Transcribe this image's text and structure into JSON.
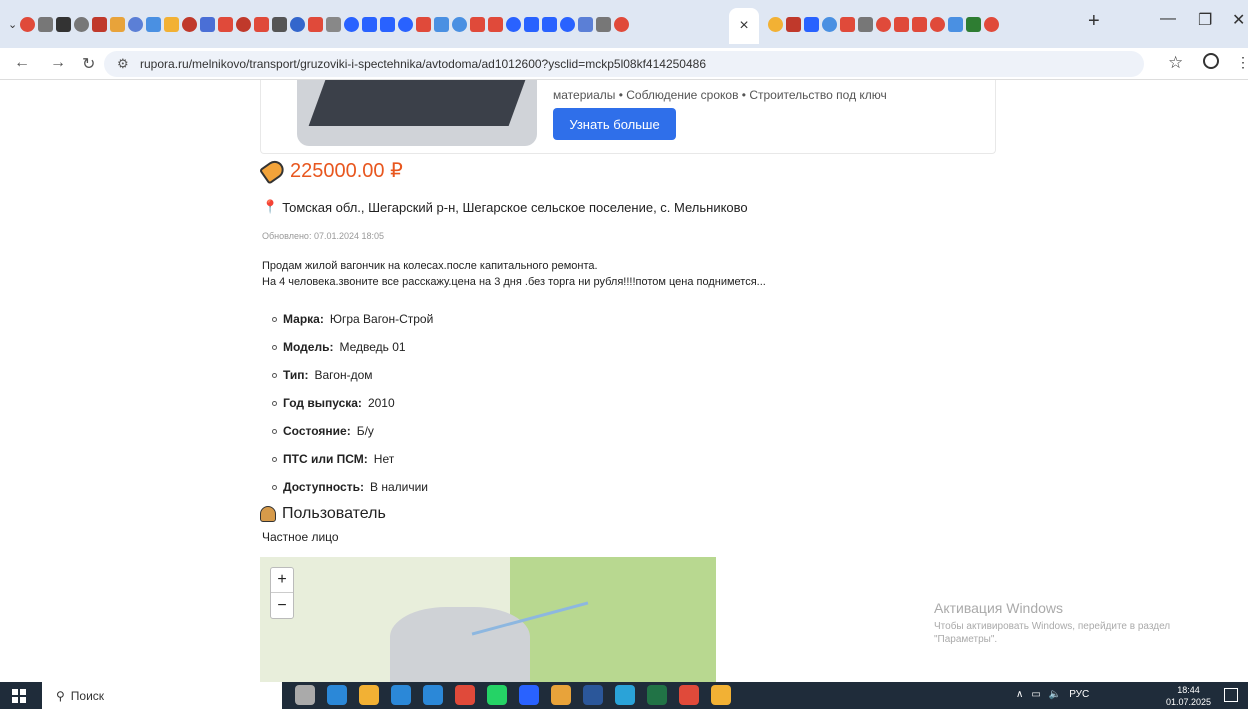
{
  "browser": {
    "url": "rupora.ru/melnikovo/transport/gruzoviki-i-spectehnika/avtodoma/ad1012600?ysclid=mckp5l08kf414250486",
    "active_tab_close": "×",
    "new_tab": "+",
    "tab_icon_colors": [
      "#e04a3a",
      "#777",
      "#333",
      "#777",
      "#c0392b",
      "#e8a33a",
      "#5b7fd6",
      "#4a90e2",
      "#f2b134",
      "#c0392b",
      "#4a6fd6",
      "#e04a3a",
      "#c0392b",
      "#e04a3a",
      "#555",
      "#3366cc",
      "#e04a3a",
      "#888",
      "#2962ff",
      "#2962ff",
      "#2962ff",
      "#2962ff",
      "#e04a3a",
      "#4a90e2",
      "#4a90e2",
      "#e04a3a",
      "#e04a3a",
      "#2962ff",
      "#2962ff",
      "#2962ff",
      "#2962ff",
      "#5b7fd6",
      "#777",
      "#e04a3a"
    ],
    "tab_icon_colors_right": [
      "#f2b134",
      "#c0392b",
      "#2962ff",
      "#4a90e2",
      "#e04a3a",
      "#777",
      "#e04a3a",
      "#e04a3a",
      "#e04a3a",
      "#e04a3a",
      "#4a90e2",
      "#2e7d32",
      "#e04a3a"
    ]
  },
  "ad": {
    "text": "материалы • Соблюдение сроков • Строительство под ключ",
    "button": "Узнать больше"
  },
  "listing": {
    "price": "225000.00 ₽",
    "location": "Томская обл., Шегарский р-н, Шегарское сельское поселение, с. Мельниково",
    "updated": "Обновлено: 07.01.2024 18:05",
    "description_line1": "Продам жилой вагончик на колесах.после капитального ремонта.",
    "description_line2": "На 4 человека.звоните все расскажу.цена на 3 дня .без торга ни рубля!!!!потом цена поднимется...",
    "specs": [
      {
        "label": "Марка:",
        "value": "Югра Вагон-Строй"
      },
      {
        "label": "Модель:",
        "value": "Медведь 01"
      },
      {
        "label": "Тип:",
        "value": "Вагон-дом"
      },
      {
        "label": "Год выпуска:",
        "value": "2010"
      },
      {
        "label": "Состояние:",
        "value": "Б/у"
      },
      {
        "label": "ПТС или ПСМ:",
        "value": "Нет"
      },
      {
        "label": "Доступность:",
        "value": "В наличии"
      }
    ],
    "user_heading": "Пользователь",
    "user_type": "Частное лицо"
  },
  "map": {
    "zoom_in": "+",
    "zoom_out": "−"
  },
  "activation": {
    "title": "Активация Windows",
    "line1": "Чтобы активировать Windows, перейдите в раздел",
    "line2": "\"Параметры\"."
  },
  "taskbar": {
    "search_label": "Поиск",
    "language": "РУС",
    "time": "18:44",
    "date": "01.07.2025",
    "app_colors": [
      "#aaa",
      "#2b88d8",
      "#f2b134",
      "#2b88d8",
      "#2b88d8",
      "#e04a3a",
      "#25d366",
      "#2962ff",
      "#e8a33a",
      "#2b579a",
      "#2aa3d8",
      "#217346",
      "#e04a3a",
      "#f2b134"
    ]
  }
}
